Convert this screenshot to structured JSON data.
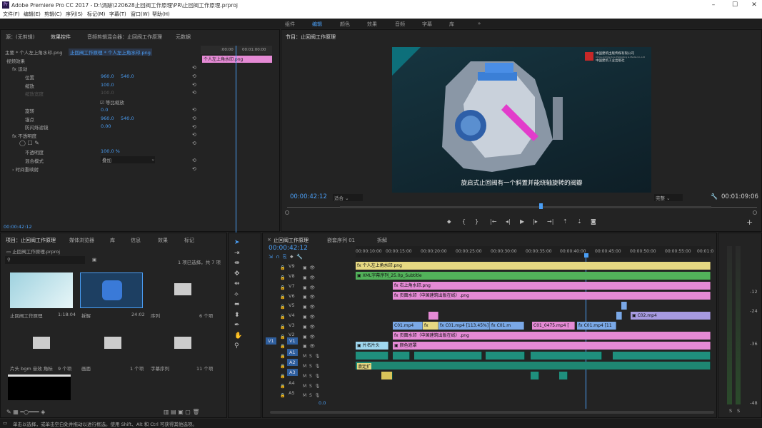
{
  "app": {
    "title": "Adobe Premiere Pro CC 2017 - D:\\涓跡\\220628止回阀工作原理\\PR\\止回阀工作原理.prproj",
    "logo": "Pr"
  },
  "menu": [
    "文件(F)",
    "编辑(E)",
    "剪辑(C)",
    "序列(S)",
    "标记(M)",
    "字幕(T)",
    "窗口(W)",
    "帮助(H)"
  ],
  "workspaces": [
    "组件",
    "编辑",
    "颜色",
    "效果",
    "音频",
    "字幕",
    "库"
  ],
  "source_panel": {
    "tabs": [
      "源：(无剪辑)",
      "效果控件",
      "音频剪辑混合器：止回阀工作原理",
      "元数据"
    ],
    "clip_header": "主要 * 个人左上角水印.png",
    "clip_link": "止回阀工作原理 * 个人左上角水印.png",
    "mini_ruler": [
      ":00:00",
      "00:01:00:00"
    ],
    "mini_clip": "个人左上角水印.png",
    "video_effects_label": "视频效果",
    "rows": [
      {
        "label": "运动",
        "value1": "",
        "value2": ""
      },
      {
        "label": "位置",
        "value1": "960.0",
        "value2": "540.0"
      },
      {
        "label": "缩放",
        "value1": "100.0",
        "value2": ""
      },
      {
        "label": "缩放宽度",
        "value1": "100.0",
        "value2": ""
      },
      {
        "label": "等比缩放",
        "value1": "",
        "value2": ""
      },
      {
        "label": "旋转",
        "value1": "0.0",
        "value2": ""
      },
      {
        "label": "锚点",
        "value1": "960.0",
        "value2": "540.0"
      },
      {
        "label": "防闪烁滤镜",
        "value1": "0.00",
        "value2": ""
      },
      {
        "label": "不透明度",
        "value1": "",
        "value2": ""
      },
      {
        "label": "不透明度",
        "value1": "100.0 %",
        "value2": ""
      },
      {
        "label": "混合模式",
        "value1": "叠加",
        "value2": ""
      },
      {
        "label": "时间重映射",
        "value1": "",
        "value2": ""
      }
    ],
    "timecode": "00:00:42:12"
  },
  "program": {
    "title": "节目：止回阀工作原理",
    "subtitle": "旋启式止回阀有一个斜置并能绕轴旋转的阀瓣",
    "publisher_cn": "中国建筑出版传媒有限公司",
    "publisher_en": "China Architecture Publishing & Media Co.,Ltd",
    "publisher_cn2": "中国建筑工业出版社",
    "timecode_left": "00:00:42:12",
    "fit": "适合",
    "quality": "完整",
    "timecode_right": "00:01:09:06"
  },
  "project": {
    "tabs": [
      "项目：止回阀工作原理",
      "媒体浏览器",
      "库",
      "信息",
      "效果",
      "标记"
    ],
    "file": "止回阀工作原理.prproj",
    "selection": "1 项已选择，共 7 项",
    "items": [
      {
        "name": "止回阀工作原理",
        "meta": "1:18:04"
      },
      {
        "name": "拆解",
        "meta": "24:02"
      },
      {
        "name": "序列",
        "meta": "6 个项"
      },
      {
        "name": "片头 bgm 音效 角标",
        "meta": "9 个项"
      },
      {
        "name": "画面",
        "meta": "1 个项"
      },
      {
        "name": "字幕序列",
        "meta": "11 个项"
      }
    ]
  },
  "timeline": {
    "tabs": [
      "止回阀工作原理",
      "嵌套序列 01",
      "拆解"
    ],
    "timecode": "00:00:42:12",
    "ruler": [
      "00:00:10:00",
      "00:00:15:00",
      "00:00:20:00",
      "00:00:25:00",
      "00:00:30:00",
      "00:00:35:00",
      "00:00:40:00",
      "00:00:45:00",
      "00:00:50:00",
      "00:00:55:00",
      "00:01:0"
    ],
    "video_tracks": [
      "V9",
      "V8",
      "V7",
      "V6",
      "V5",
      "V4",
      "V3",
      "V2",
      "V1"
    ],
    "audio_tracks": [
      "A1",
      "A2",
      "A3",
      "A4",
      "A5"
    ],
    "source_patch": "V1",
    "master_value": "0.0",
    "clips": {
      "v9": "个人左上角水印.png",
      "v8": "XML字幕序列_25.0p_Subtitle",
      "v7": "右上角水印.png",
      "v6": "页面水印（中国建筑出版在线）.png",
      "v4": "C02.mp4",
      "v3": [
        "C01.mp4",
        "C01.mp4 [113.45%]",
        "C01.m",
        "C01_0475.mp4 [",
        "C01.mp4 [11"
      ],
      "v2": "页面水印（中国建筑出版在线）.png",
      "v1a": "片名片头",
      "v1b": "颜色遮罩",
      "a2": "滑定扩"
    }
  },
  "meter": {
    "scale": [
      "-12",
      "-24",
      "-36",
      "-48"
    ],
    "solo": [
      "S",
      "S"
    ]
  },
  "status": "单击以选择，或单击空白处并拖动以进行框选。使用 Shift、Alt 和 Ctrl 可获得其他选项。"
}
